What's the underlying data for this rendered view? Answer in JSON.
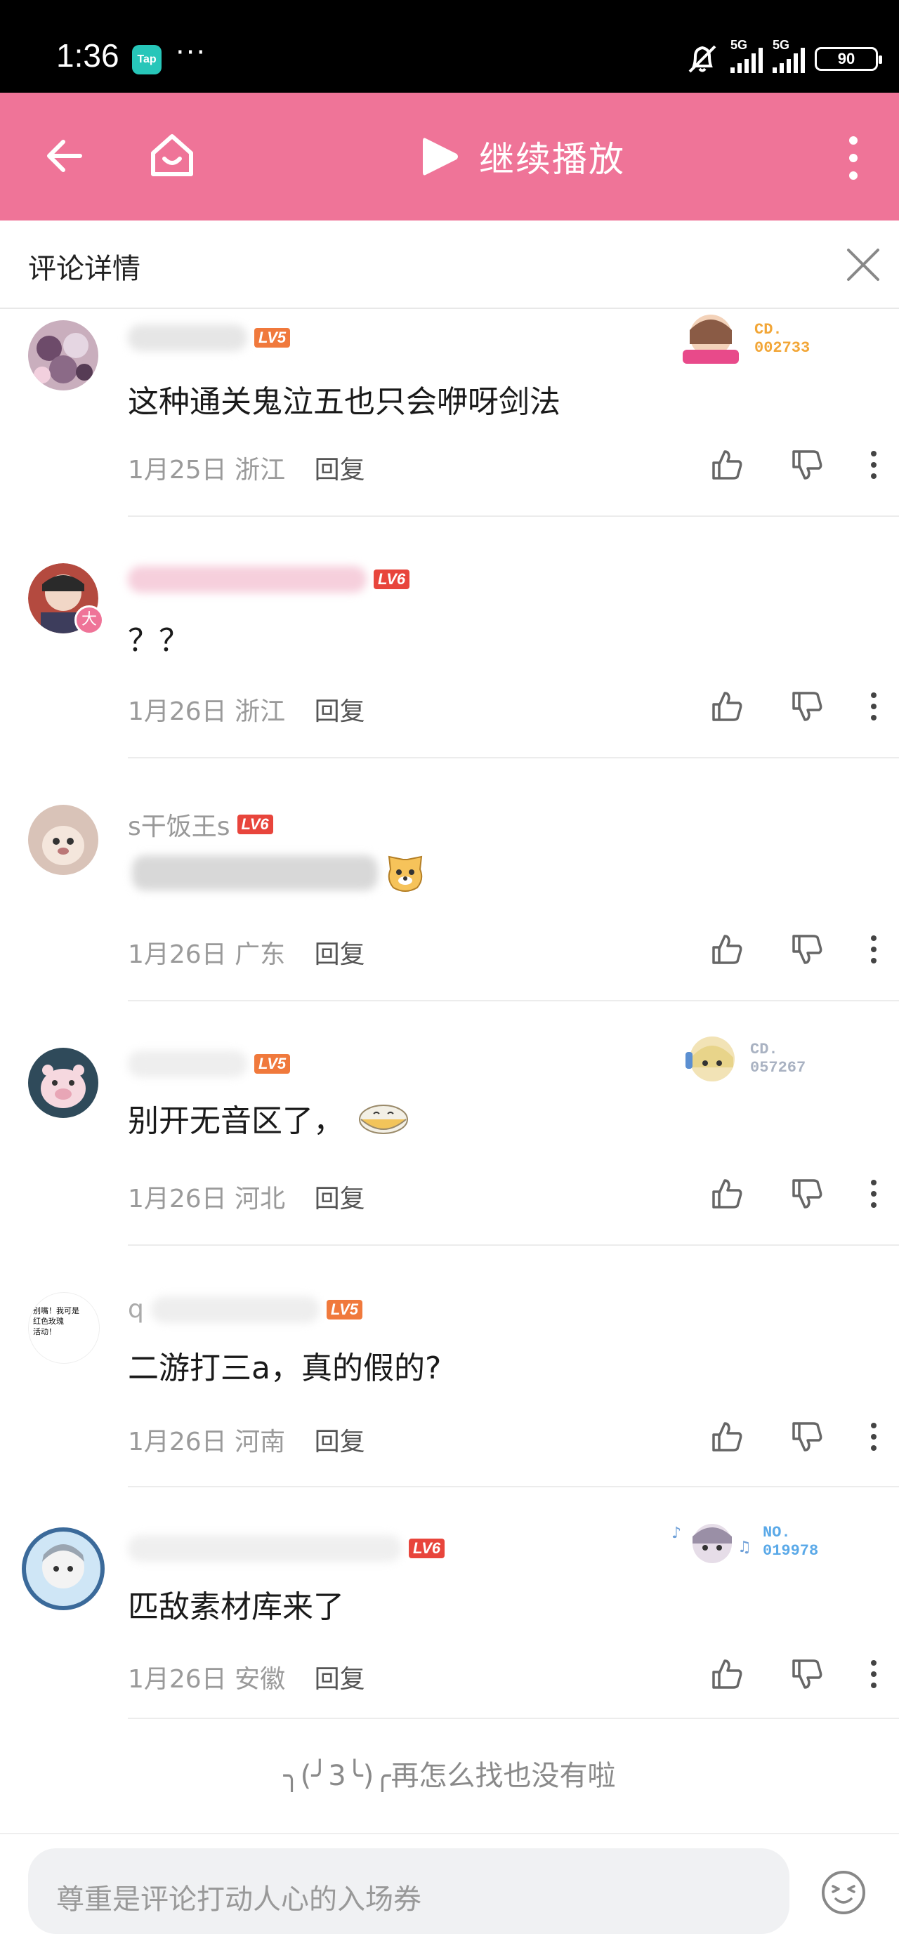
{
  "status_bar": {
    "time": "1:36",
    "app_icon": "Tap",
    "overflow": "···",
    "network1": "5G",
    "network2": "5G",
    "battery": "90"
  },
  "app_bar": {
    "play_label": "继续播放",
    "icons": [
      "back-arrow-icon",
      "home-icon",
      "play-icon",
      "more-vertical-icon"
    ],
    "bg_color": "#ef7498"
  },
  "panel": {
    "title": "评论详情"
  },
  "comments": [
    {
      "name": "",
      "level": "LV5",
      "text": "这种通关鬼泣五也只会咿呀剑法",
      "date": "1月25日",
      "location": "浙江",
      "reply_label": "回复",
      "badge": "CD.\n002733"
    },
    {
      "name": "",
      "level": "LV6",
      "text": "？？",
      "date": "1月26日",
      "location": "浙江",
      "reply_label": "回复",
      "avatar_tag": "大"
    },
    {
      "name": "s干饭王s",
      "level": "LV6",
      "text": "",
      "date": "1月26日",
      "location": "广东",
      "reply_label": "回复"
    },
    {
      "name": "",
      "level": "LV5",
      "text": "别开无音区了，",
      "date": "1月26日",
      "location": "河北",
      "reply_label": "回复",
      "badge": "CD.\n057267"
    },
    {
      "name": "q",
      "level": "LV5",
      "text": "二游打三a，真的假的?",
      "date": "1月26日",
      "location": "河南",
      "reply_label": "回复",
      "avatar_text": "别嘴！我可是\n红色玫瑰\n活动！"
    },
    {
      "name": "",
      "level": "LV6",
      "text": "匹敌素材库来了",
      "date": "1月26日",
      "location": "安徽",
      "reply_label": "回复",
      "badge": "NO.\n019978"
    }
  ],
  "end_message": "╮(╯3╰)╭再怎么找也没有啦",
  "input": {
    "placeholder": "尊重是评论打动人心的入场券"
  },
  "colors": {
    "lv5": "#f0793c",
    "lv6": "#e8453c",
    "pink": "#ef7498"
  }
}
